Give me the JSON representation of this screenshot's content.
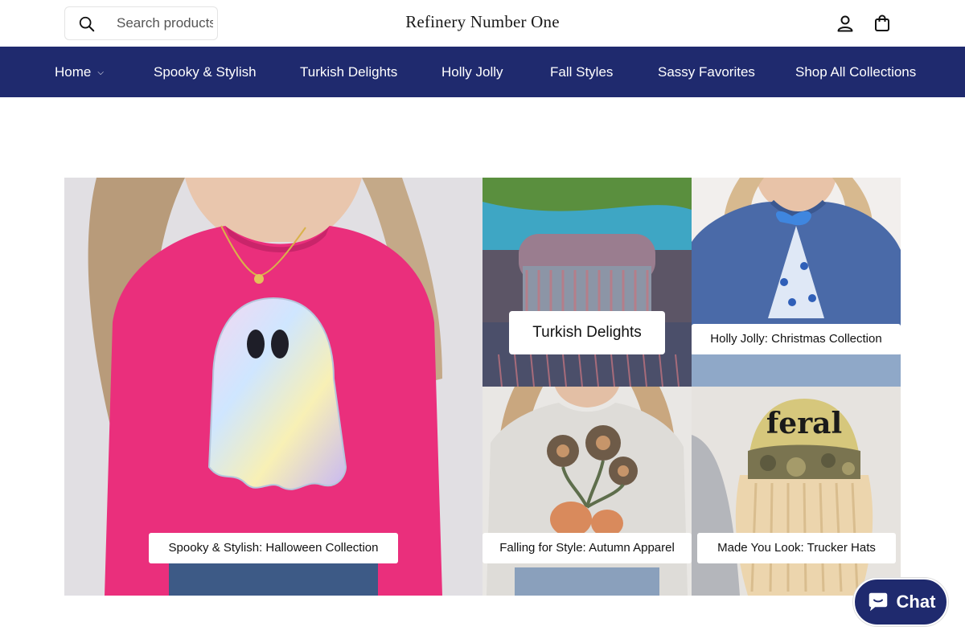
{
  "header": {
    "search_placeholder": "Search products",
    "brand": "Refinery Number One",
    "icons": [
      "search-icon",
      "account-icon",
      "cart-icon"
    ]
  },
  "nav": {
    "items": [
      {
        "label": "Home",
        "has_dropdown": true
      },
      {
        "label": "Spooky & Stylish"
      },
      {
        "label": "Turkish Delights"
      },
      {
        "label": "Holly Jolly"
      },
      {
        "label": "Fall Styles"
      },
      {
        "label": "Sassy Favorites"
      },
      {
        "label": "Shop All Collections"
      }
    ]
  },
  "collections": [
    {
      "label": "Spooky & Stylish: Halloween Collection"
    },
    {
      "label": "Turkish Delights"
    },
    {
      "label": "Holly Jolly: Christmas Collection"
    },
    {
      "label": "Falling for Style: Autumn Apparel"
    },
    {
      "label": "Made You Look: Trucker Hats"
    }
  ],
  "chat": {
    "label": "Chat"
  },
  "colors": {
    "nav_bg": "#1f2a6e",
    "accent": "#1f2a6e"
  }
}
